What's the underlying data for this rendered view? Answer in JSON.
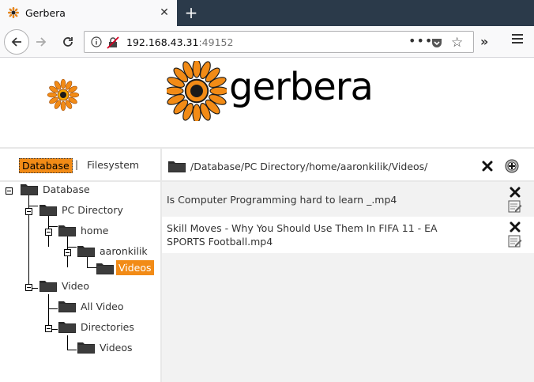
{
  "browser": {
    "tab_title": "Gerbera",
    "tab_close": "✕",
    "new_tab": "+",
    "url_host": "192.168.43.31",
    "url_port": ":49152",
    "more_dots": "•••",
    "overflow": "»"
  },
  "header": {
    "brand": "gerbera"
  },
  "left": {
    "tab_database": "Database",
    "separator": "|",
    "tab_filesystem": "Filesystem",
    "tree": {
      "database": "Database",
      "pc_directory": "PC Directory",
      "home": "home",
      "aaronkilik": "aaronkilik",
      "videos_selected": "Videos",
      "video": "Video",
      "all_video": "All Video",
      "directories": "Directories",
      "videos": "Videos"
    }
  },
  "right": {
    "path": "/Database/PC Directory/home/aaronkilik/Videos/",
    "items": [
      {
        "title": "Is Computer Programming hard to learn _.mp4"
      },
      {
        "title": "Skill Moves - Why You Should Use Them In FIFA 11 - EA SPORTS Football.mp4"
      }
    ]
  },
  "colors": {
    "accent": "#f28b16",
    "tabbar": "#2b3a4a"
  }
}
